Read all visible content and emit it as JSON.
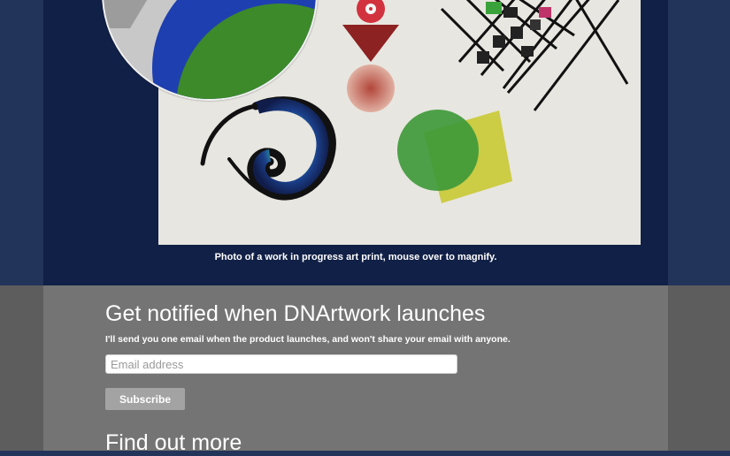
{
  "hero": {
    "image_alt": "Work in progress art print",
    "caption": "Photo of a work in progress art print, mouse over to magnify."
  },
  "signup": {
    "title": "Get notified when DNArtwork launches",
    "description": "I'll send you one email when the product launches, and won't share your email with anyone.",
    "email_placeholder": "Email address",
    "subscribe_label": "Subscribe"
  },
  "more": {
    "heading": "Find out more"
  },
  "colors": {
    "page_background": "#23345a",
    "hero_panel": "#112046",
    "signup_panel": "#747474",
    "button": "#a3a3a3"
  }
}
